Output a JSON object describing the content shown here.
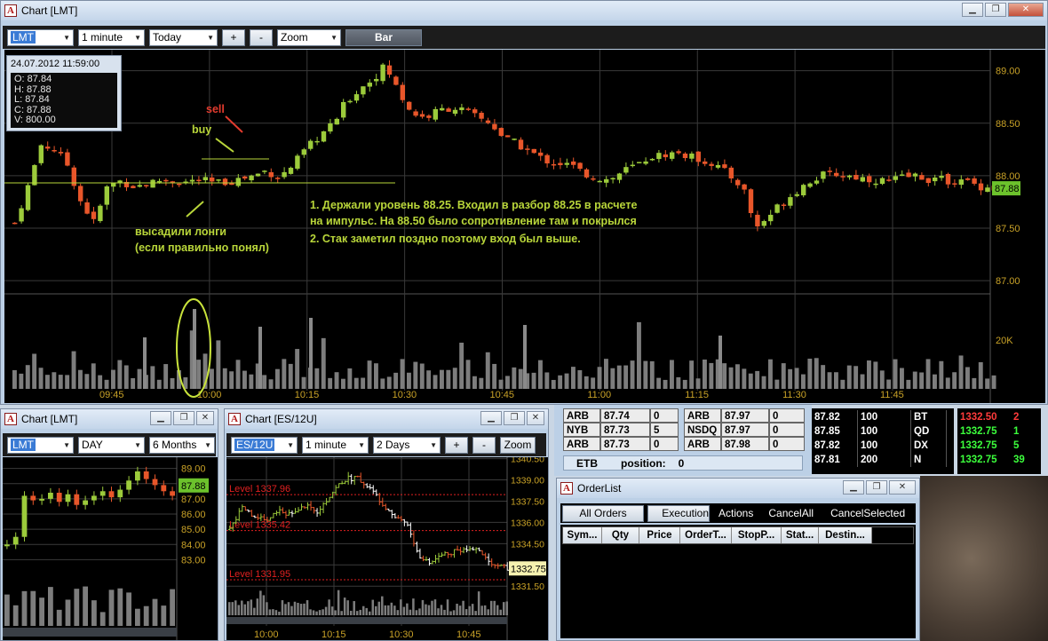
{
  "main_chart": {
    "title": "Chart [LMT]",
    "toolbar": {
      "symbol": "LMT",
      "interval": "1 minute",
      "range": "Today",
      "zoom_in": "+",
      "zoom_out": "-",
      "zoom": "Zoom",
      "style": "Bar"
    },
    "info": {
      "datetime": "24.07.2012 11:59:00",
      "open": "O: 87.84",
      "high": "H: 87.88",
      "low": "L: 87.84",
      "close": "C: 87.88",
      "volume": "V: 800.00"
    },
    "annotations": {
      "sell": "sell",
      "buy": "buy",
      "left1": "высадили лонги",
      "left2": "(если правильно понял)",
      "note1": "1. Держали уровень 88.25.  Входил в разбор 88.25 в расчете",
      "note2": "на импульс. На 88.50 было сопротивление там и покрылся",
      "note3": "2. Стак заметил поздно поэтому вход был выше."
    },
    "annotation_colors": {
      "sell": "#e33b2e",
      "buy": "#b9d63a",
      "note": "#b9d63a"
    },
    "last_price": "87.88",
    "volume_label": "20K"
  },
  "chart_data": [
    {
      "type": "candlestick",
      "symbol": "LMT",
      "interval": "1 minute",
      "ylim": [
        86.9,
        89.2
      ],
      "y_ticks": [
        "89.00",
        "88.50",
        "88.00",
        "87.50",
        "87.00"
      ],
      "x_ticks": [
        "09:45",
        "10:00",
        "10:15",
        "10:30",
        "10:45",
        "11:00",
        "11:15",
        "11:30",
        "11:45"
      ],
      "close_profile": [
        87.55,
        87.9,
        88.3,
        88.25,
        88.1,
        87.75,
        87.55,
        87.9,
        87.95,
        87.9,
        87.92,
        87.96,
        87.95,
        87.94,
        87.96,
        87.93,
        87.94,
        87.97,
        88.0,
        88.05,
        87.98,
        88.1,
        88.25,
        88.38,
        88.48,
        88.7,
        88.82,
        88.92,
        89.05,
        88.8,
        88.6,
        88.55,
        88.62,
        88.65,
        88.62,
        88.55,
        88.5,
        88.35,
        88.3,
        88.22,
        88.15,
        88.12,
        88.1,
        88.02,
        87.98,
        87.96,
        88.05,
        88.1,
        88.18,
        88.2,
        88.22,
        88.18,
        88.15,
        88.1,
        88.0,
        87.9,
        87.5,
        87.62,
        87.75,
        87.85,
        87.95,
        88.0,
        88.02,
        88.0,
        87.98,
        87.96,
        87.95,
        87.98,
        88.0,
        87.97,
        87.96,
        87.95,
        87.94,
        87.9,
        87.88
      ],
      "volume_ticks": [
        "20K"
      ]
    },
    {
      "type": "candlestick",
      "symbol": "LMT",
      "interval": "DAY",
      "range": "6 Months",
      "ylim": [
        82.5,
        89.5
      ],
      "y_ticks": [
        "89.00",
        "88.00",
        "87.00",
        "86.00",
        "85.00",
        "84.00",
        "83.00"
      ],
      "last_price": "87.88"
    },
    {
      "type": "ohlc",
      "symbol": "ES/12U",
      "interval": "1 minute",
      "range": "2 Days",
      "ylim": [
        1331.2,
        1340.6
      ],
      "y_ticks": [
        "1340.50",
        "1339.00",
        "1337.50",
        "1336.00",
        "1334.50",
        "1333.00",
        "1331.50"
      ],
      "x_ticks": [
        "10:00",
        "10:15",
        "10:30",
        "10:45"
      ],
      "levels": [
        {
          "label": "Level 1337.96",
          "value": 1337.96
        },
        {
          "label": "Level 1335.42",
          "value": 1335.42
        },
        {
          "label": "Level 1331.95",
          "value": 1331.95
        }
      ],
      "last_price": "1332.75"
    }
  ],
  "small_lmt_chart": {
    "title": "Chart [LMT]",
    "toolbar": {
      "symbol": "LMT",
      "interval": "DAY",
      "range": "6 Months"
    },
    "last_price": "87.88"
  },
  "es_chart": {
    "title": "Chart [ES/12U]",
    "toolbar": {
      "symbol": "ES/12U",
      "interval": "1 minute",
      "range": "2 Days",
      "zoom_in": "+",
      "zoom_out": "-",
      "zoom": "Zoom"
    },
    "last_price": "1332.75",
    "level_labels": [
      "Level 1337.96",
      "Level 1335.42",
      "Level 1331.95"
    ]
  },
  "level2_left": [
    [
      "ARB",
      "87.74",
      "0"
    ],
    [
      "NYB",
      "87.73",
      "5"
    ],
    [
      "ARB",
      "87.73",
      "0"
    ]
  ],
  "level2_right": [
    [
      "ARB",
      "87.97",
      "0"
    ],
    [
      "NSDQ",
      "87.97",
      "0"
    ],
    [
      "ARB",
      "87.98",
      "0"
    ]
  ],
  "position_bar": {
    "etb": "ETB",
    "position_label": "position:",
    "position_value": "0"
  },
  "time_sales": [
    [
      "87.82",
      "100",
      "BT"
    ],
    [
      "87.85",
      "100",
      "QD"
    ],
    [
      "87.82",
      "100",
      "DX"
    ],
    [
      "87.81",
      "200",
      "N"
    ]
  ],
  "es_tape": [
    {
      "price": "1332.50",
      "size": "2",
      "color": "#ff3b3b"
    },
    {
      "price": "1332.75",
      "size": "1",
      "color": "#3cff3c"
    },
    {
      "price": "1332.75",
      "size": "5",
      "color": "#3cff3c"
    },
    {
      "price": "1332.75",
      "size": "39",
      "color": "#3cff3c"
    }
  ],
  "orderlist": {
    "title": "OrderList",
    "tabs": [
      "All Orders",
      "Execution"
    ],
    "actions": [
      "Actions",
      "CancelAll",
      "CancelSelected"
    ],
    "columns": [
      "Sym...",
      "Qty",
      "Price",
      "OrderT...",
      "StopP...",
      "Stat...",
      "Destin..."
    ]
  },
  "colors": {
    "up": "#9ccb3b",
    "down": "#e8562a",
    "grid": "#3a3a3a",
    "axis_text": "#c9a227",
    "level": "#e02020"
  }
}
